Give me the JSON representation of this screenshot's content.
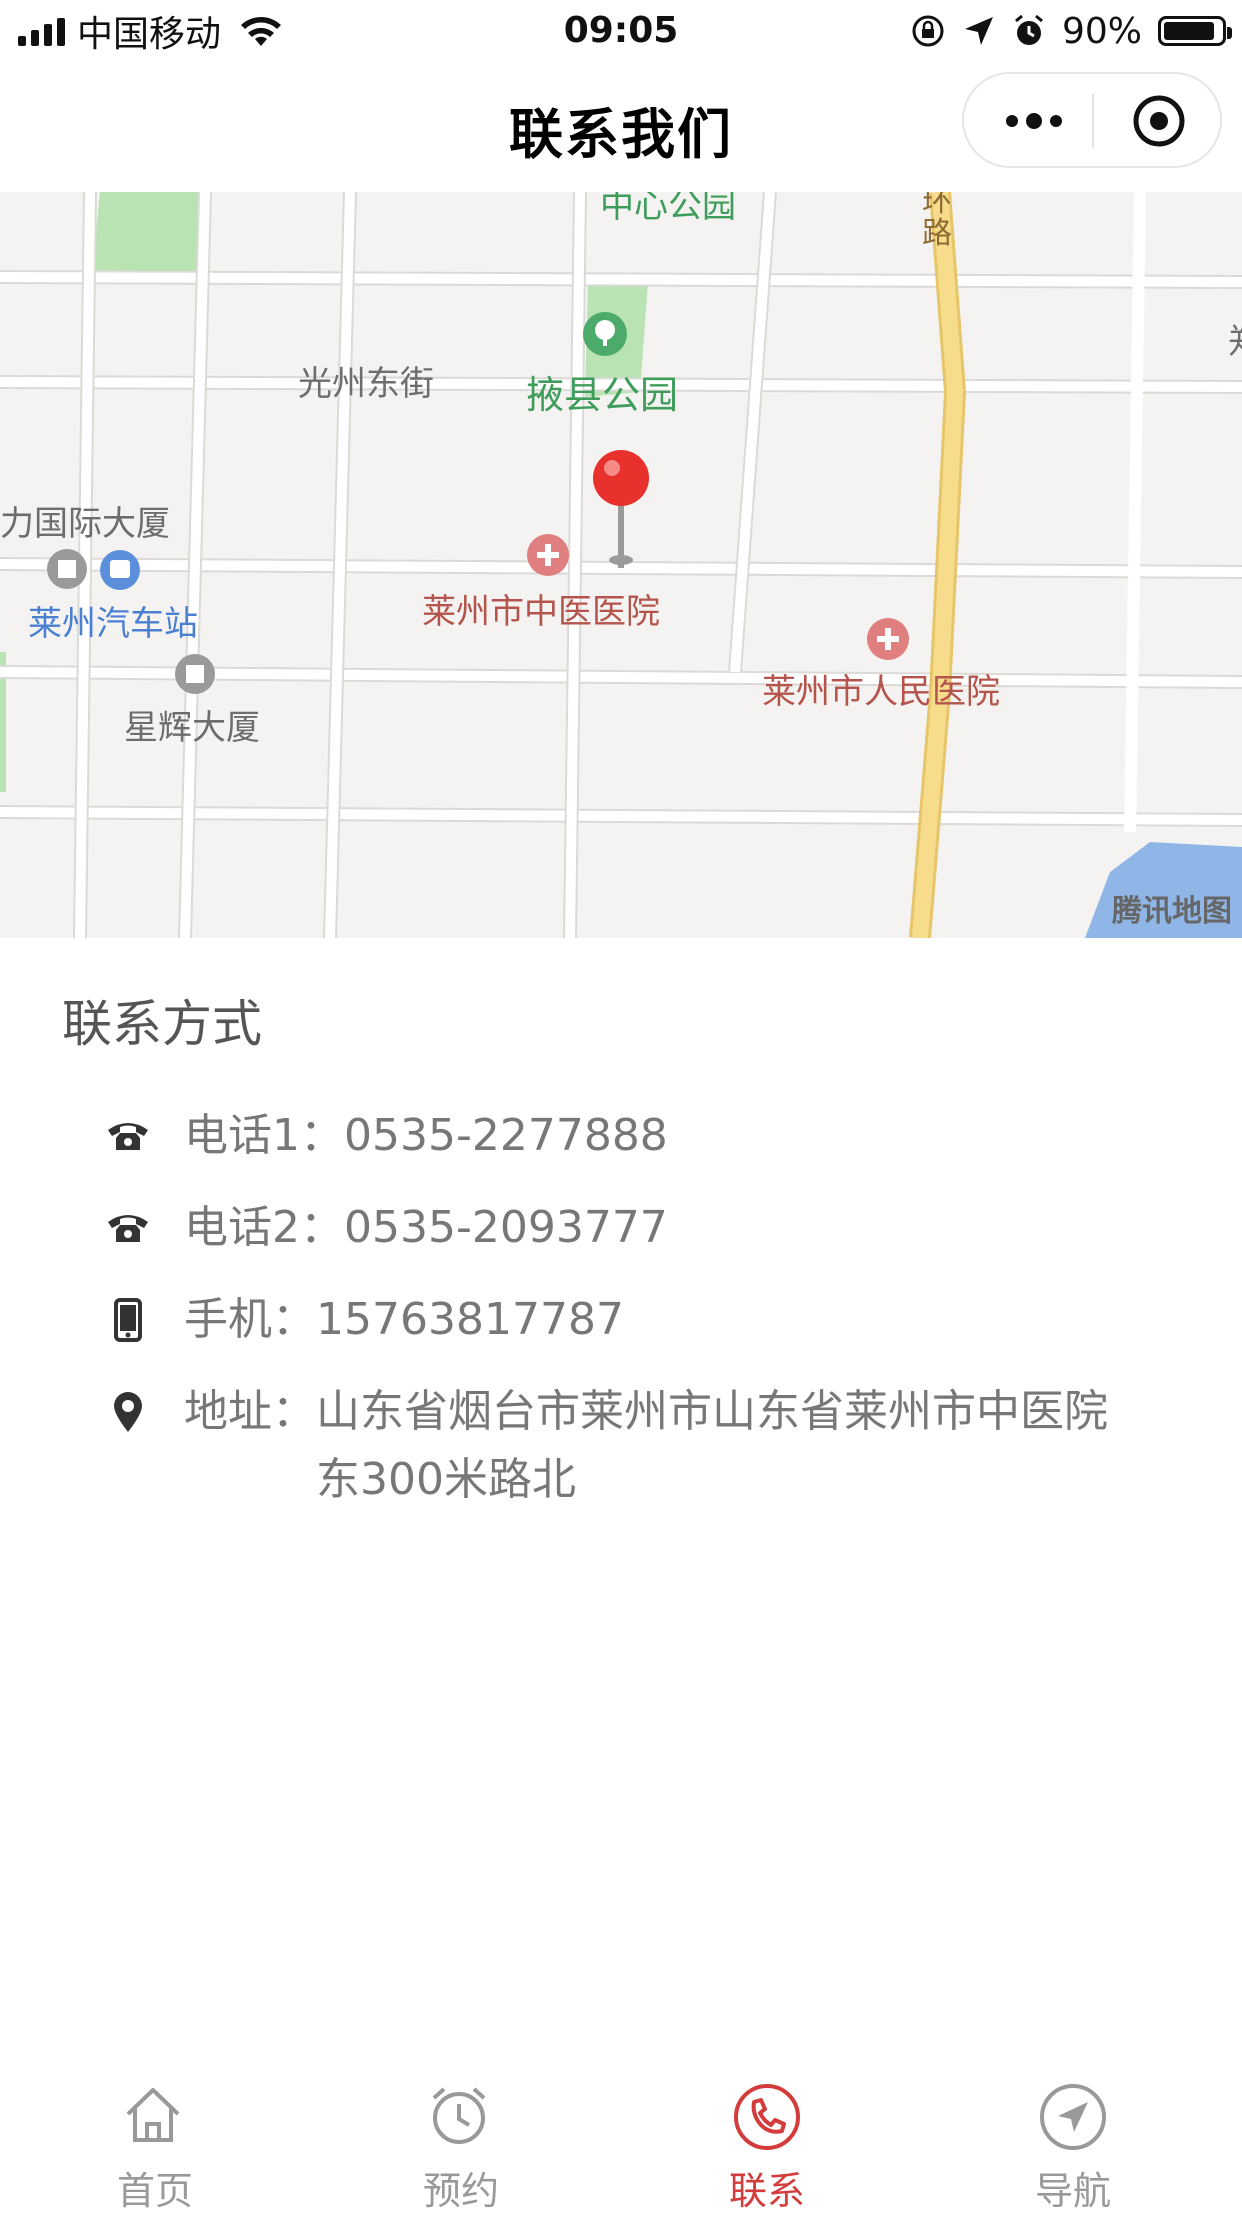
{
  "status_bar": {
    "carrier": "中国移动",
    "time": "09:05",
    "battery": "90%",
    "battery_level": 0.9
  },
  "nav": {
    "title": "联系我们"
  },
  "map": {
    "labels": {
      "park_top": "中心公园",
      "ring_road": "环路",
      "street": "光州东街",
      "park": "掖县公园",
      "building_left": "力国际大厦",
      "bus_station": "莱州汽车站",
      "star_building": "星辉大厦",
      "tcm_hospital": "莱州市中医医院",
      "peoples_hospital": "莱州市人民医院",
      "edge_char": "郑"
    },
    "watermark": "腾讯地图",
    "colors": {
      "road_ring": "#f5d37a",
      "park": "#b9e3b3",
      "water": "#8fb6e6",
      "pin": "#e8302c"
    }
  },
  "contact": {
    "title": "联系方式",
    "phone1": "电话1：0535-2277888",
    "phone2": "电话2：0535-2093777",
    "mobile": "手机：15763817787",
    "address_label": "地址：",
    "address_value": "山东省烟台市莱州市山东省莱州市中医院东300米路北"
  },
  "tabs": [
    {
      "label": "首页",
      "icon": "home-icon"
    },
    {
      "label": "预约",
      "icon": "alarm-clock-icon"
    },
    {
      "label": "联系",
      "icon": "phone-icon",
      "active": true
    },
    {
      "label": "导航",
      "icon": "navigation-arrow-icon"
    }
  ],
  "accent_color": "#d43c3c"
}
